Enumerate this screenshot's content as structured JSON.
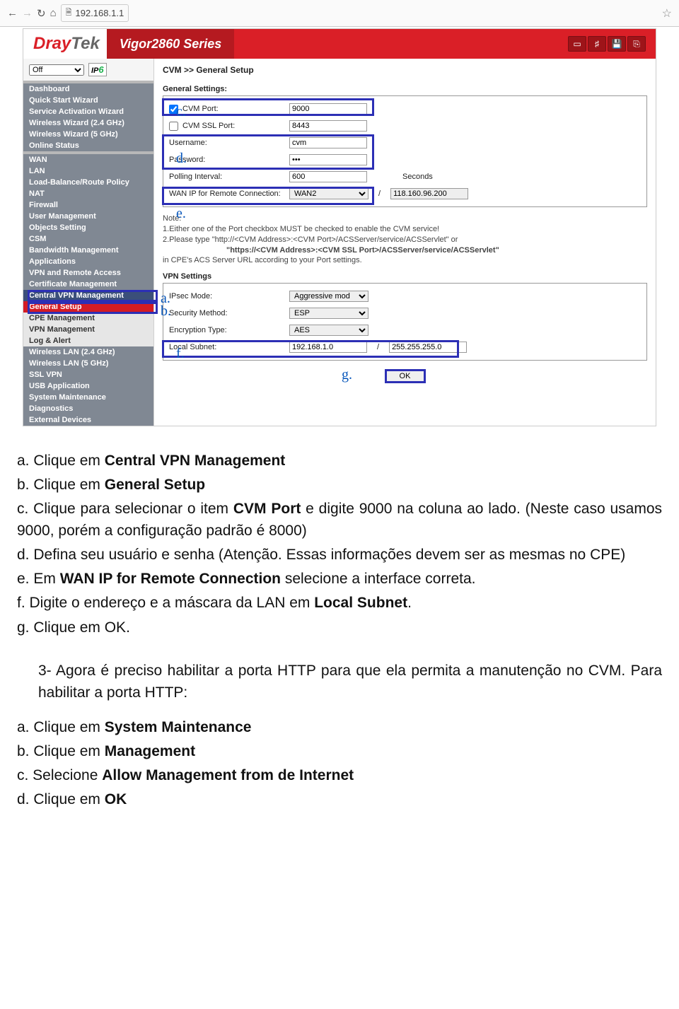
{
  "browser": {
    "url": "192.168.1.1"
  },
  "header": {
    "logo1": "Dray",
    "logo2": "Tek",
    "series_prefix": "Vigor",
    "series_model": "2860",
    "series_suffix": "Series"
  },
  "sidebar": {
    "off_select": "Off",
    "ipv": "IP",
    "ipv_six": "6",
    "group1": [
      "Dashboard",
      "Quick Start Wizard",
      "Service Activation Wizard",
      "Wireless Wizard (2.4 GHz)",
      "Wireless Wizard (5 GHz)",
      "Online Status"
    ],
    "group2": [
      "WAN",
      "LAN",
      "Load-Balance/Route Policy",
      "NAT",
      "Firewall",
      "User Management",
      "Objects Setting",
      "CSM",
      "Bandwidth Management",
      "Applications",
      "VPN and Remote Access",
      "Certificate Management",
      "Central VPN Management"
    ],
    "group2_sub": [
      "General Setup",
      "CPE Management",
      "VPN Management",
      "Log & Alert"
    ],
    "group3": [
      "Wireless LAN (2.4 GHz)",
      "Wireless LAN (5 GHz)",
      "SSL VPN",
      "USB Application",
      "System Maintenance",
      "Diagnostics",
      "External Devices"
    ]
  },
  "content": {
    "breadcrumb": "CVM >> General Setup",
    "section1": "General Settings:",
    "cvm_port_label": "CVM Port:",
    "cvm_port_value": "9000",
    "cvm_ssl_label": "CVM SSL Port:",
    "cvm_ssl_value": "8443",
    "username_label": "Username:",
    "username_value": "cvm",
    "password_label": "Password:",
    "password_value": "•••",
    "polling_label": "Polling Interval:",
    "polling_value": "600",
    "polling_unit": "Seconds",
    "wanip_label": "WAN IP for Remote Connection:",
    "wanip_select": "WAN2",
    "wanip_slash": "/",
    "wanip_value": "118.160.96.200",
    "note_title": "Note:",
    "note1": "1.Either one of the Port checkbox MUST be checked to enable the CVM service!",
    "note2a": "2.Please type \"http://<CVM Address>:<CVM Port>/ACSServer/service/ACSServlet\" or",
    "note2b": "\"https://<CVM Address>:<CVM SSL Port>/ACSServer/service/ACSServlet\"",
    "note3": "in CPE's ACS Server URL according to your Port settings.",
    "section2": "VPN Settings",
    "ipsec_label": "IPsec Mode:",
    "ipsec_value": "Aggressive mod",
    "secmethod_label": "Security Method:",
    "secmethod_value": "ESP",
    "enc_label": "Encryption Type:",
    "enc_value": "AES",
    "local_subnet_label": "Local Subnet:",
    "local_subnet_ip": "192.168.1.0",
    "local_subnet_mask": "255.255.255.0",
    "ok_btn": "OK"
  },
  "callouts": {
    "a": "a.",
    "b": "b.",
    "c": "c.",
    "d": "d.",
    "e": "e.",
    "f": "f.",
    "g": "g."
  },
  "doc": {
    "a_prefix": "a. Clique em ",
    "a_bold": "Central VPN Management",
    "b_prefix": "b. Clique em ",
    "b_bold": "General Setup",
    "c_prefix": "c. Clique para selecionar o item ",
    "c_bold": "CVM Port",
    "c_suffix": " e digite 9000 na coluna ao lado. (Neste caso usamos 9000, porém a configuração padrão é 8000)",
    "d_text": "d. Defina seu usuário e senha (Atenção. Essas informações devem ser as mesmas no CPE)",
    "e_prefix": "e. Em ",
    "e_bold": "WAN IP for Remote Connection",
    "e_suffix": " selecione a interface correta.",
    "f_prefix": "f. Digite o endereço e a máscara da LAN em ",
    "f_bold": "Local Subnet",
    "f_suffix": ".",
    "g_text": "g. Clique em OK.",
    "step3": "3- Agora é preciso habilitar a porta HTTP para que ela permita a manutenção no CVM. Para habilitar a porta HTTP:",
    "s2a_prefix": "a. Clique em ",
    "s2a_bold": "System Maintenance",
    "s2b_prefix": "b. Clique em ",
    "s2b_bold": "Management",
    "s2c_prefix": "c. Selecione ",
    "s2c_bold": "Allow Management from de Internet",
    "s2d_prefix": "d. Clique em ",
    "s2d_bold": "OK"
  }
}
